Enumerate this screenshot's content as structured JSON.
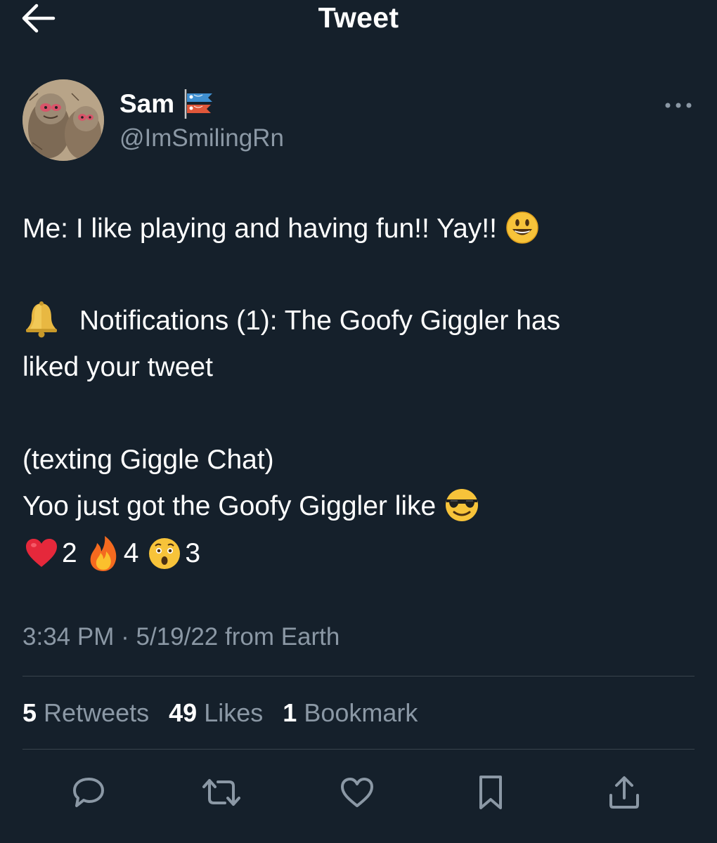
{
  "header": {
    "title": "Tweet",
    "back_icon": "arrow-left-icon"
  },
  "author": {
    "name": "Sam",
    "handle": "@ImSmilingRn",
    "flag_icon": "carp-streamer-icon",
    "avatar_icon": "monkey-avatar"
  },
  "tweet": {
    "line1": "Me: I like playing and having fun!! Yay!!",
    "line2": "Notifications (1): The Goofy Giggler has",
    "line3": "liked your tweet",
    "line4": "(texting Giggle Chat)",
    "line5": "Yoo just got the Goofy Giggler like",
    "reactions": [
      {
        "icon": "heart-icon",
        "count": "2"
      },
      {
        "icon": "fire-icon",
        "count": "4"
      },
      {
        "icon": "astonished-face-icon",
        "count": "3"
      }
    ]
  },
  "meta": {
    "time": "3:34 PM",
    "separator": "·",
    "date_source": "5/19/22 from Earth"
  },
  "stats": {
    "retweets_count": "5",
    "retweets_label": "Retweets",
    "likes_count": "49",
    "likes_label": "Likes",
    "bookmarks_count": "1",
    "bookmarks_label": "Bookmark"
  },
  "actions": [
    "reply-icon",
    "retweet-icon",
    "like-icon",
    "bookmark-icon",
    "share-icon"
  ],
  "colors": {
    "background": "#15202b",
    "text": "#ffffff",
    "secondary": "#8b98a5",
    "divider": "#38444d"
  }
}
